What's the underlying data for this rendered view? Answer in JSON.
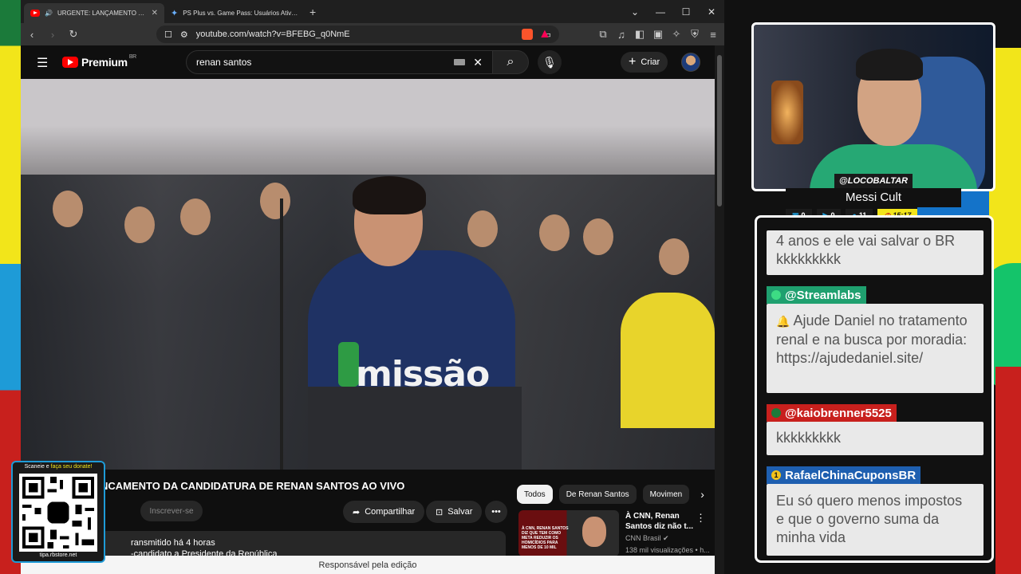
{
  "browser": {
    "tabs": [
      {
        "label": "URGENTE: LANÇAMENTO DA CANDIDATURA",
        "active": true
      },
      {
        "label": "PS Plus vs. Game Pass: Usuários Ativos - Goo",
        "active": false
      }
    ],
    "url": "youtube.com/watch?v=BFEBG_q0NmE",
    "status_text": "Responsável pela edição"
  },
  "youtube": {
    "logo_text": "Premium",
    "logo_region": "BR",
    "search_value": "renan santos",
    "create_label": "Criar",
    "video_title": "NCAMENTO DA CANDIDATURA DE RENAN SANTOS AO VIVO",
    "podium_text": "missão",
    "subscribe_label": "Inscrever-se",
    "share_label": "Compartilhar",
    "save_label": "Salvar",
    "description_line1": "ransmitido há 4 horas",
    "description_line2": "-candidato a Presidente da República",
    "chips": [
      "Todos",
      "De Renan Santos",
      "Movimen"
    ],
    "recommended": {
      "title": "À CNN, Renan Santos diz não t...",
      "channel": "CNN Brasil",
      "views": "138 mil visualizações • h...",
      "thumb_text": "À CNN, RENAN SANTOS DIZ QUE TEM COMO META REDUZIR OS HOMICÍDIOS PARA MENOS DE 10 MIL"
    }
  },
  "qr": {
    "top_prefix": "Scaneie e ",
    "top_highlight": "faça seu donate!",
    "bottom": "tipa.rbstore.net"
  },
  "stream": {
    "handle": "@LOCOBALTAR",
    "title": "Messi Cult",
    "stats": [
      "0",
      "0",
      "11"
    ],
    "timer": "15:17"
  },
  "chat": {
    "messages": [
      {
        "user": "",
        "text": "4 anos e ele vai salvar o BR kkkkkkkkk"
      },
      {
        "user": "@Streamlabs",
        "text": "Ajude Daniel no tratamento renal e na busca por moradia: https://ajudedaniel.site/"
      },
      {
        "user": "@kaiobrenner5525",
        "text": "kkkkkkkkk"
      },
      {
        "user": "RafaelChinaCuponsBR",
        "text": "Eu só quero menos impostos e que o governo suma da minha vida"
      }
    ],
    "colors": {
      "streamlabs": "#1fa06f",
      "kaio": "#c8201d",
      "rafael": "#1e5fb0"
    }
  }
}
